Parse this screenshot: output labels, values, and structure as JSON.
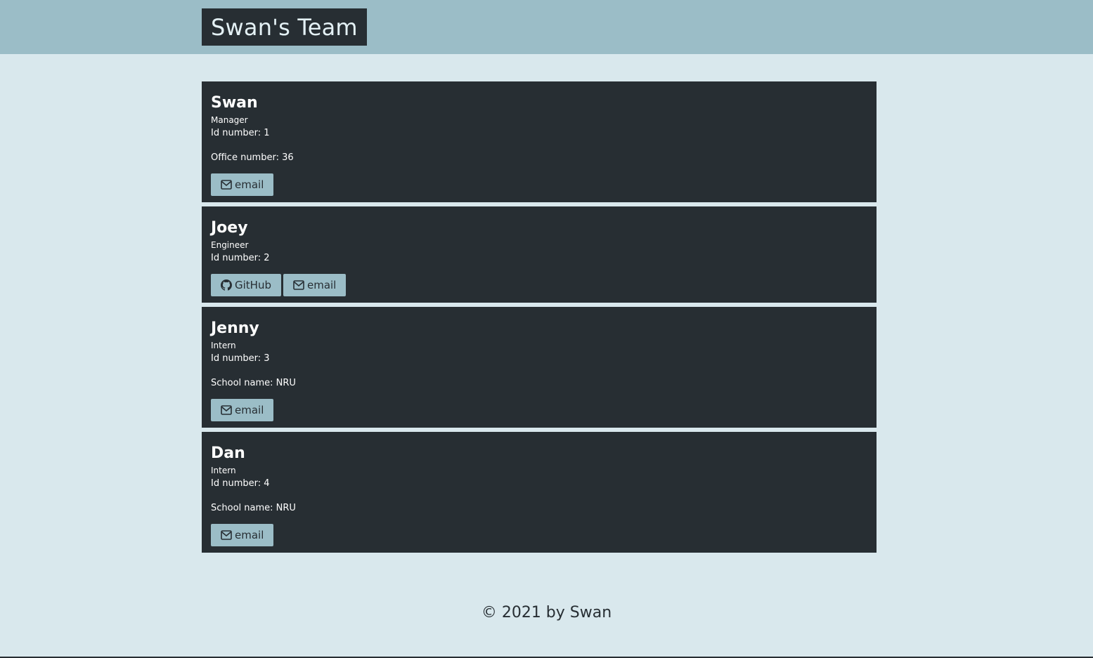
{
  "header": {
    "title": "Swan's Team"
  },
  "team": [
    {
      "name": "Swan",
      "role": "Manager",
      "id_text": "Id number: 1",
      "extra_text": "Office number: 36",
      "buttons": [
        {
          "label": "email",
          "icon": "mail-icon"
        }
      ]
    },
    {
      "name": "Joey",
      "role": "Engineer",
      "id_text": "Id number: 2",
      "extra_text": "",
      "buttons": [
        {
          "label": "GitHub",
          "icon": "github-icon"
        },
        {
          "label": "email",
          "icon": "mail-icon"
        }
      ]
    },
    {
      "name": "Jenny",
      "role": "Intern",
      "id_text": "Id number: 3",
      "extra_text": "School name: NRU",
      "buttons": [
        {
          "label": "email",
          "icon": "mail-icon"
        }
      ]
    },
    {
      "name": "Dan",
      "role": "Intern",
      "id_text": "Id number: 4",
      "extra_text": "School name: NRU",
      "buttons": [
        {
          "label": "email",
          "icon": "mail-icon"
        }
      ]
    }
  ],
  "footer": {
    "text": "© 2021 by Swan"
  },
  "colors": {
    "page_bg": "#d9e8ed",
    "header_bg": "#9bbdc7",
    "card_bg": "#272e33",
    "button_bg": "#9bbdc7"
  }
}
